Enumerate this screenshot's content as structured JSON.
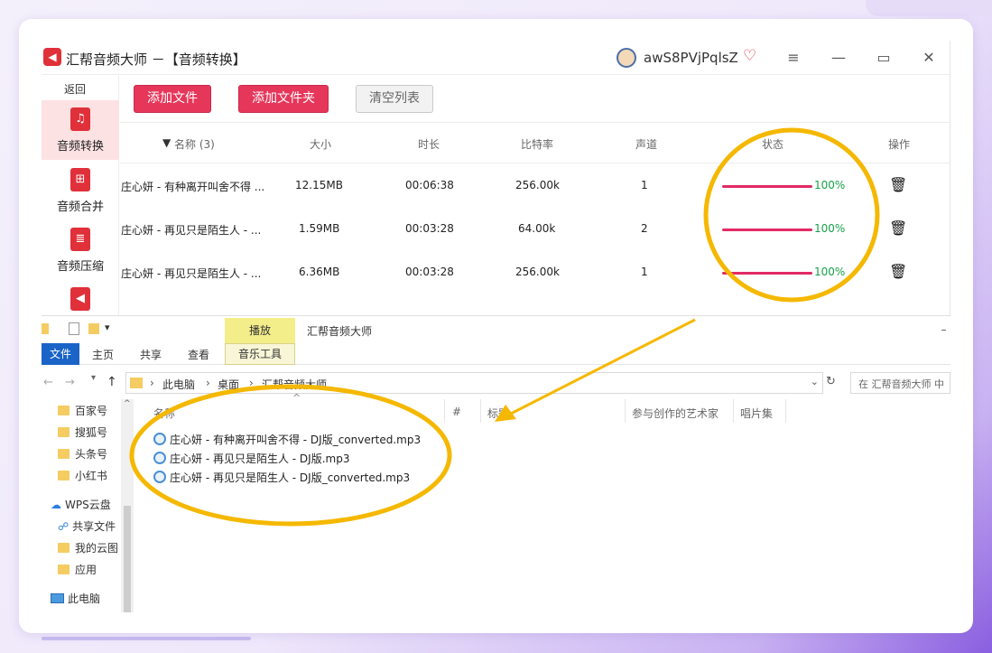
{
  "app": {
    "name": "汇帮音频大师",
    "section": "－【音频转换】",
    "user_name": "awS8PVjPqlsZ",
    "logo_icon": "speaker-icon",
    "window_controls": [
      "menu-icon",
      "minimize-icon",
      "maximize-icon",
      "close-icon"
    ],
    "accent_color": "#e6375b"
  },
  "sidebar": {
    "back_label": "返回",
    "items": [
      {
        "label": "音频转换",
        "icon": "audio-convert-icon",
        "active": true
      },
      {
        "label": "音频合并",
        "icon": "audio-merge-icon",
        "active": false
      },
      {
        "label": "音频压缩",
        "icon": "audio-compress-icon",
        "active": false
      }
    ]
  },
  "toolbar": {
    "add_file": "添加文件",
    "add_folder": "添加文件夹",
    "clear_list": "清空列表"
  },
  "table": {
    "headers": {
      "sort_arrow": "▼",
      "name": "名称 (3)",
      "size": "大小",
      "duration": "时长",
      "bitrate": "比特率",
      "channels": "声道",
      "status": "状态",
      "action": "操作"
    },
    "rows": [
      {
        "name": "庄心妍 - 有种离开叫舍不得 ...",
        "size": "12.15MB",
        "duration": "00:06:38",
        "bitrate": "256.00k",
        "channels": "1",
        "progress": 1.0,
        "progress_text": "100%"
      },
      {
        "name": "庄心妍 - 再见只是陌生人 - ...",
        "size": "1.59MB",
        "duration": "00:03:28",
        "bitrate": "64.00k",
        "channels": "2",
        "progress": 1.0,
        "progress_text": "100%"
      },
      {
        "name": "庄心妍 - 再见只是陌生人 - ...",
        "size": "6.36MB",
        "duration": "00:03:28",
        "bitrate": "256.00k",
        "channels": "1",
        "progress": 1.0,
        "progress_text": "100%"
      }
    ],
    "progress_color": "#e22a64",
    "status_text_color": "#15a049"
  },
  "explorer": {
    "contextual_tab": "播放",
    "title": "汇帮音频大师",
    "ribbon_tabs": [
      "文件",
      "主页",
      "共享",
      "查看",
      "音乐工具"
    ],
    "address": {
      "this_pc": "此电脑",
      "desktop": "桌面",
      "folder": "汇帮音频大师"
    },
    "search_placeholder": "在 汇帮音频大师 中",
    "nav_items": [
      "百家号",
      "搜狐号",
      "头条号",
      "小红书",
      "WPS云盘",
      "共享文件",
      "我的云图",
      "应用",
      "此电脑"
    ],
    "columns": [
      "名称",
      "#",
      "标题",
      "参与创作的艺术家",
      "唱片集"
    ],
    "files": [
      "庄心妍 - 有种离开叫舍不得 - DJ版_converted.mp3",
      "庄心妍 - 再见只是陌生人 - DJ版.mp3",
      "庄心妍 - 再见只是陌生人 - DJ版_converted.mp3"
    ]
  },
  "annotation_color": "#f5b800"
}
